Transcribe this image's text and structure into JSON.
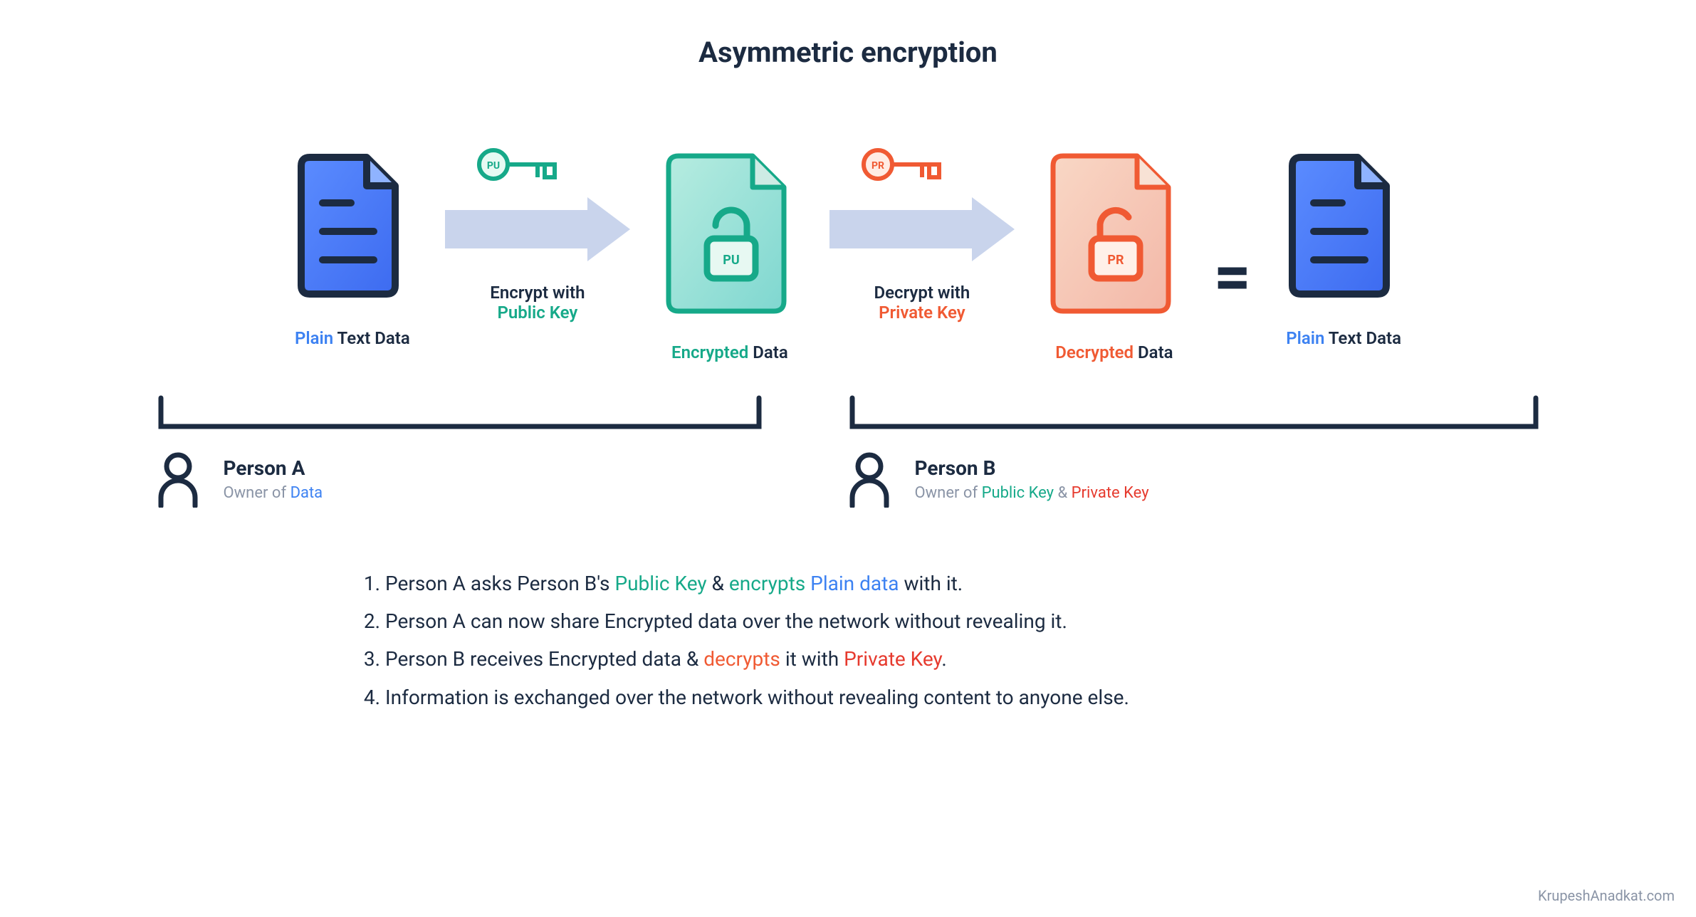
{
  "title": "Asymmetric encryption",
  "stages": {
    "plain": {
      "word1": "Plain",
      "word2": " Text Data"
    },
    "enc": {
      "word1": "Encrypted",
      "word2": " Data"
    },
    "dec": {
      "word1": "Decrypted",
      "word2": " Data"
    },
    "plain2": {
      "word1": "Plain",
      "word2": " Text Data"
    }
  },
  "arrows": {
    "encrypt": {
      "line1": "Encrypt with",
      "line2": "Public Key",
      "key_badge": "PU"
    },
    "decrypt": {
      "line1": "Decrypt with",
      "line2": "Private Key",
      "key_badge": "PR"
    }
  },
  "locks": {
    "encrypted_badge": "PU",
    "decrypted_badge": "PR"
  },
  "equals": "=",
  "persons": {
    "a": {
      "name": "Person A",
      "desc_pre": "Owner of ",
      "desc_hl": "Data"
    },
    "b": {
      "name": "Person B",
      "desc_pre": "Owner of ",
      "desc_pub": "Public Key",
      "desc_amp": " & ",
      "desc_priv": "Private Key"
    }
  },
  "steps": {
    "s1": {
      "a": "Person A asks Person B's ",
      "b": "Public Key",
      "c": " & ",
      "d": "encrypts ",
      "e": "Plain data",
      "f": " with it."
    },
    "s2": {
      "a": "Person A can now share Encrypted data over the network without revealing it."
    },
    "s3": {
      "a": "Person B receives Encrypted data & ",
      "b": "decrypts",
      "c": " it with ",
      "d": "Private Key",
      "e": "."
    },
    "s4": {
      "a": "Information is exchanged over the network without revealing content to anyone else."
    }
  },
  "credit": "KrupeshAnadkat.com",
  "colors": {
    "blue": "#3d82f2",
    "teal": "#16a989",
    "orange": "#f05a33",
    "red": "#e63a2e",
    "darknavy": "#1c2b41",
    "arrowfill": "#c9d4ec"
  }
}
